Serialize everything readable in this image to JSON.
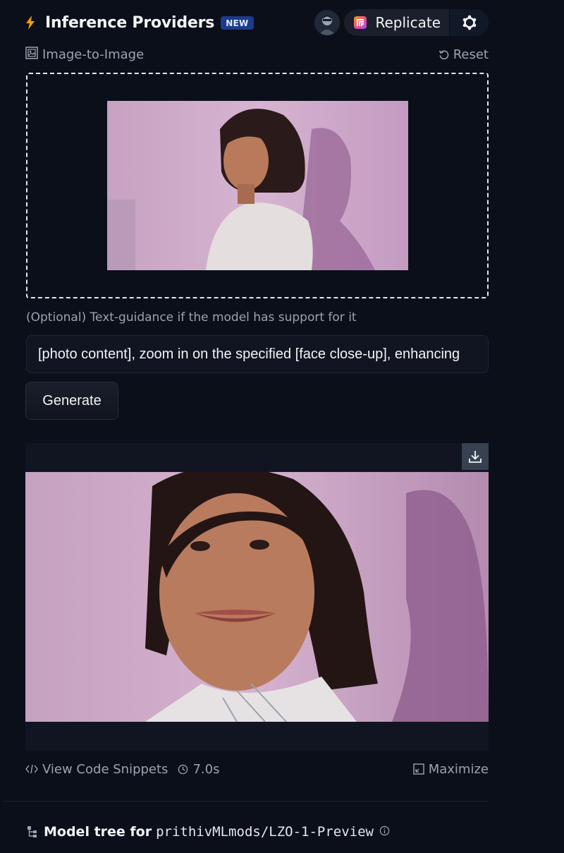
{
  "header": {
    "title": "Inference Providers",
    "badge": "NEW",
    "provider_name": "Replicate",
    "icons": {
      "bolt": "lightning-bolt-icon",
      "avatar": "user-avatar",
      "provider": "replicate-logo-icon",
      "settings": "settings-gear-icon"
    }
  },
  "task": {
    "label": "Image-to-Image",
    "reset_label": "Reset"
  },
  "guidance": {
    "label": "(Optional) Text-guidance if the model has support for it",
    "prompt_value": "[photo content], zoom in on the specified [face close-up], enhancing"
  },
  "generate_label": "Generate",
  "footer": {
    "code_snippets_label": "View Code Snippets",
    "time_label": "7.0s",
    "maximize_label": "Maximize"
  },
  "model_tree": {
    "label": "Model tree for",
    "repo": "prithivMLmods/LZO-1-Preview"
  },
  "colors": {
    "background": "#0b0f19",
    "accent_bolt": "#f59e0b",
    "badge_bg": "#1e3a8a",
    "muted_text": "#9ca3af"
  }
}
